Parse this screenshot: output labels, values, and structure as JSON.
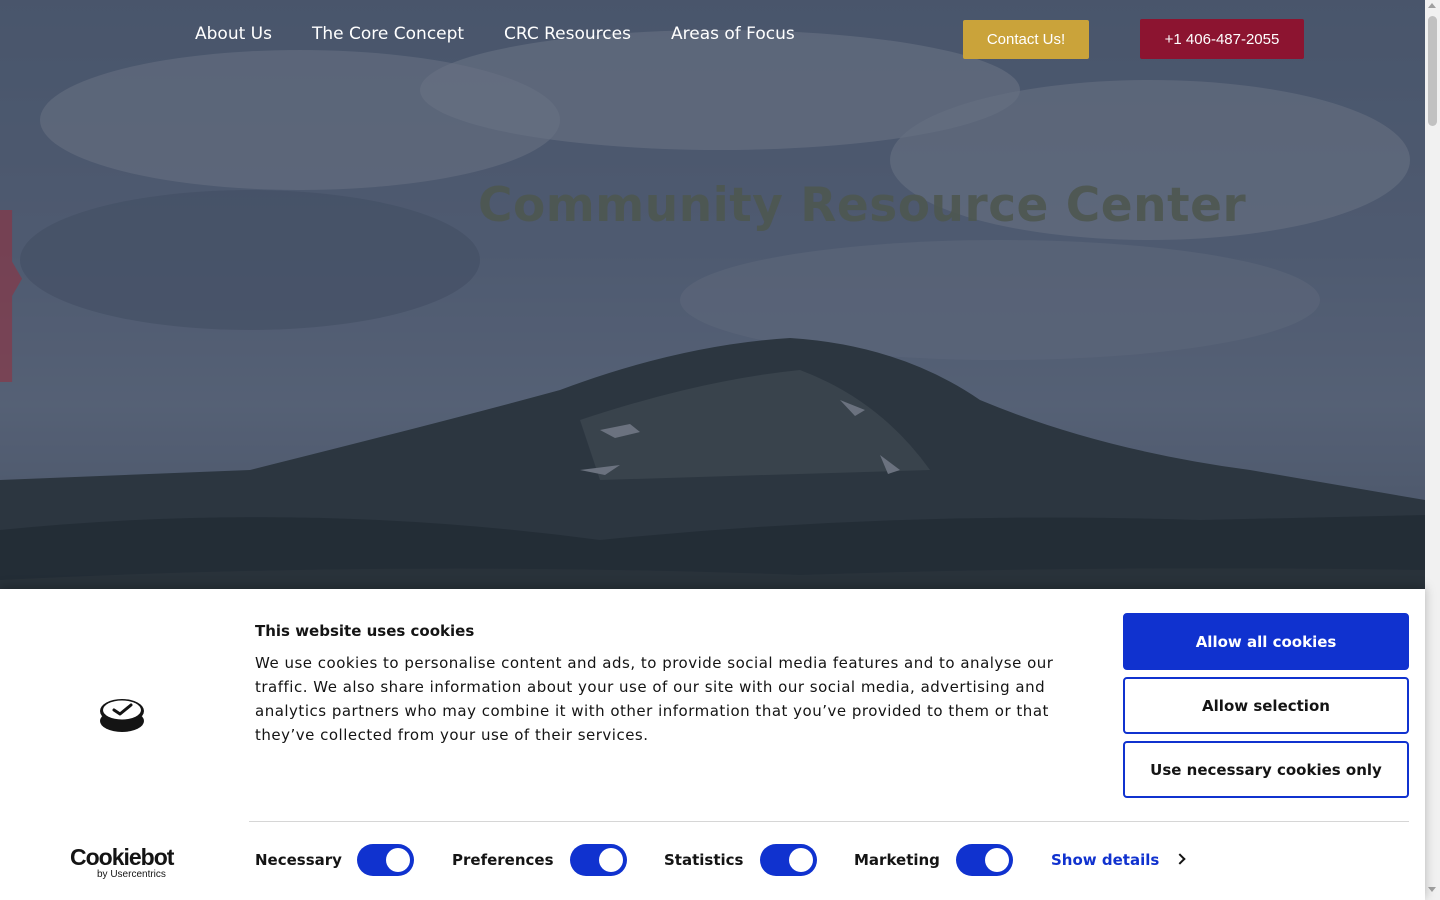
{
  "nav": {
    "items": [
      {
        "label": "About Us"
      },
      {
        "label": "The Core Concept"
      },
      {
        "label": "CRC Resources"
      },
      {
        "label": "Areas of Focus"
      }
    ],
    "contact_label": "Contact Us!",
    "phone_label": "+1 406-487-2055"
  },
  "hero": {
    "title": "Community Resource Center"
  },
  "cookie_banner": {
    "title": "This website uses cookies",
    "text": "We use cookies to personalise content and ads, to provide social media features and to analyse our traffic. We also share information about your use of our site with our social media, advertising and analytics partners who may combine it with other information that you’ve provided to them or that they’ve collected from your use of their services.",
    "buttons": {
      "allow_all": "Allow all cookies",
      "allow_selection": "Allow selection",
      "necessary_only": "Use necessary cookies only"
    },
    "brand": {
      "name": "Cookiebot",
      "byline": "by Usercentrics"
    },
    "toggles": [
      {
        "label": "Necessary",
        "on": true
      },
      {
        "label": "Preferences",
        "on": true
      },
      {
        "label": "Statistics",
        "on": true
      },
      {
        "label": "Marketing",
        "on": true
      }
    ],
    "show_details": "Show details"
  },
  "colors": {
    "accent_blue": "#1032cf",
    "contact_gold": "#caa33a",
    "phone_red": "#8c1430"
  }
}
